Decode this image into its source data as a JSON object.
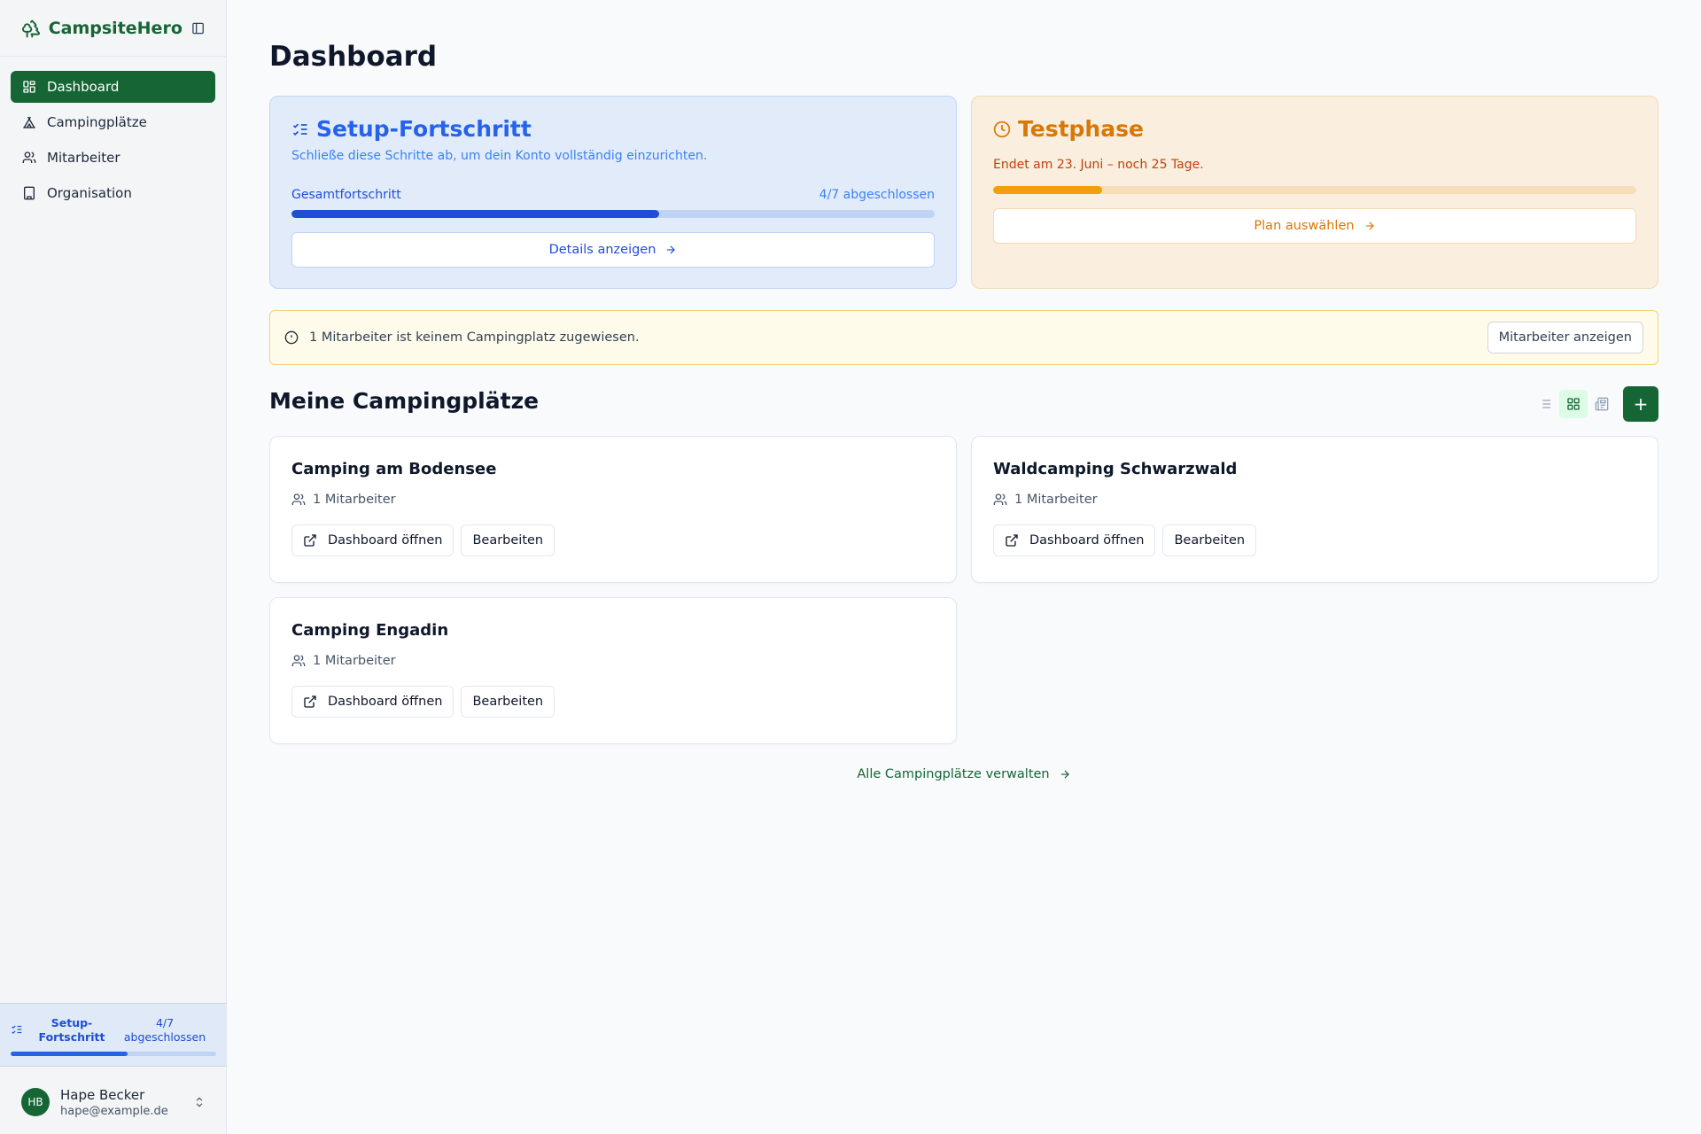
{
  "brand": {
    "name": "CampsiteHero"
  },
  "nav": {
    "items": [
      {
        "label": "Dashboard",
        "icon": "grid-icon",
        "active": true
      },
      {
        "label": "Campingplätze",
        "icon": "tent-icon"
      },
      {
        "label": "Mitarbeiter",
        "icon": "users-icon"
      },
      {
        "label": "Organisation",
        "icon": "building-icon"
      }
    ]
  },
  "sidebar_progress": {
    "label": "Setup-Fortschritt",
    "count": "4/7 abgeschlossen",
    "progress": 0.571
  },
  "user": {
    "initials": "HB",
    "name": "Hape Becker",
    "email": "hape@example.de"
  },
  "page": {
    "title": "Dashboard"
  },
  "setup_card": {
    "title": "Setup-Fortschritt",
    "description": "Schließe diese Schritte ab, um dein Konto vollständig einzurichten.",
    "progress_label": "Gesamtfortschritt",
    "progress_count": "4/7 abgeschlossen",
    "progress": 0.571,
    "button": "Details anzeigen"
  },
  "trial_card": {
    "title": "Testphase",
    "description": "Endet am 23. Juni – noch 25 Tage.",
    "progress": 0.17,
    "button": "Plan auswählen"
  },
  "alert": {
    "message": "1 Mitarbeiter ist keinem Campingplatz zugewiesen.",
    "button": "Mitarbeiter anzeigen"
  },
  "campsites_section": {
    "title": "Meine Campingplätze",
    "view_modes": [
      "list",
      "grid",
      "compact"
    ],
    "active_view": "grid",
    "add_label": "+"
  },
  "campsites": [
    {
      "name": "Camping am Bodensee",
      "staff": "1 Mitarbeiter",
      "open_label": "Dashboard öffnen",
      "edit_label": "Bearbeiten"
    },
    {
      "name": "Waldcamping Schwarzwald",
      "staff": "1 Mitarbeiter",
      "open_label": "Dashboard öffnen",
      "edit_label": "Bearbeiten"
    },
    {
      "name": "Camping Engadin",
      "staff": "1 Mitarbeiter",
      "open_label": "Dashboard öffnen",
      "edit_label": "Bearbeiten"
    }
  ],
  "manage_link": "Alle Campingplätze verwalten",
  "colors": {
    "brand": "#166534",
    "setup_accent": "#1d4ed8",
    "trial_accent": "#d97706",
    "alert_border": "#f3d17a"
  }
}
